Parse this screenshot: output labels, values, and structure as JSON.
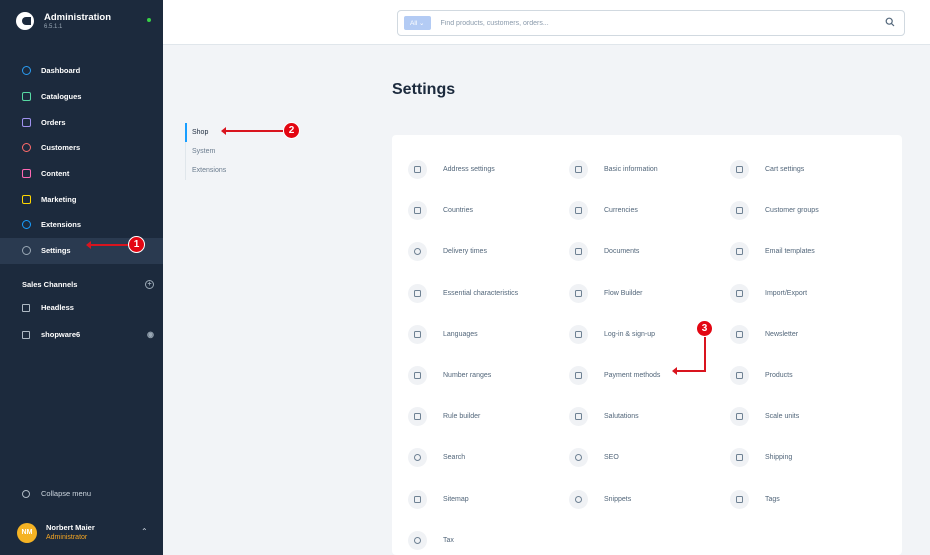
{
  "brand": {
    "title": "Administration",
    "version": "6.5.1.1"
  },
  "nav": [
    {
      "label": "Dashboard",
      "color": "#2a9df4"
    },
    {
      "label": "Catalogues",
      "color": "#57d9a3"
    },
    {
      "label": "Orders",
      "color": "#a092f0"
    },
    {
      "label": "Customers",
      "color": "#ff6b6b"
    },
    {
      "label": "Content",
      "color": "#ff68b4"
    },
    {
      "label": "Marketing",
      "color": "#ffd700"
    },
    {
      "label": "Extensions",
      "color": "#189eff"
    },
    {
      "label": "Settings",
      "color": "#9aa8b5"
    }
  ],
  "sales_channels": {
    "title": "Sales Channels",
    "items": [
      {
        "label": "Headless"
      },
      {
        "label": "shopware6"
      }
    ]
  },
  "collapse_label": "Collapse menu",
  "user": {
    "initials": "NM",
    "name": "Norbert Maier",
    "role": "Administrator"
  },
  "search": {
    "type": "All",
    "placeholder": "Find products, customers, orders..."
  },
  "page_title": "Settings",
  "tabs": [
    "Shop",
    "System",
    "Extensions"
  ],
  "settings_items": [
    "Address settings",
    "Basic information",
    "Cart settings",
    "Countries",
    "Currencies",
    "Customer groups",
    "Delivery times",
    "Documents",
    "Email templates",
    "Essential characteristics",
    "Flow Builder",
    "Import/Export",
    "Languages",
    "Log-in & sign-up",
    "Newsletter",
    "Number ranges",
    "Payment methods",
    "Products",
    "Rule builder",
    "Salutations",
    "Scale units",
    "Search",
    "SEO",
    "Shipping",
    "Sitemap",
    "Snippets",
    "Tags",
    "Tax"
  ],
  "markers": [
    "1",
    "2",
    "3"
  ],
  "colors": {
    "sidebar": "#1c2a3d",
    "accent": "#189eff",
    "marker": "#e30612"
  }
}
